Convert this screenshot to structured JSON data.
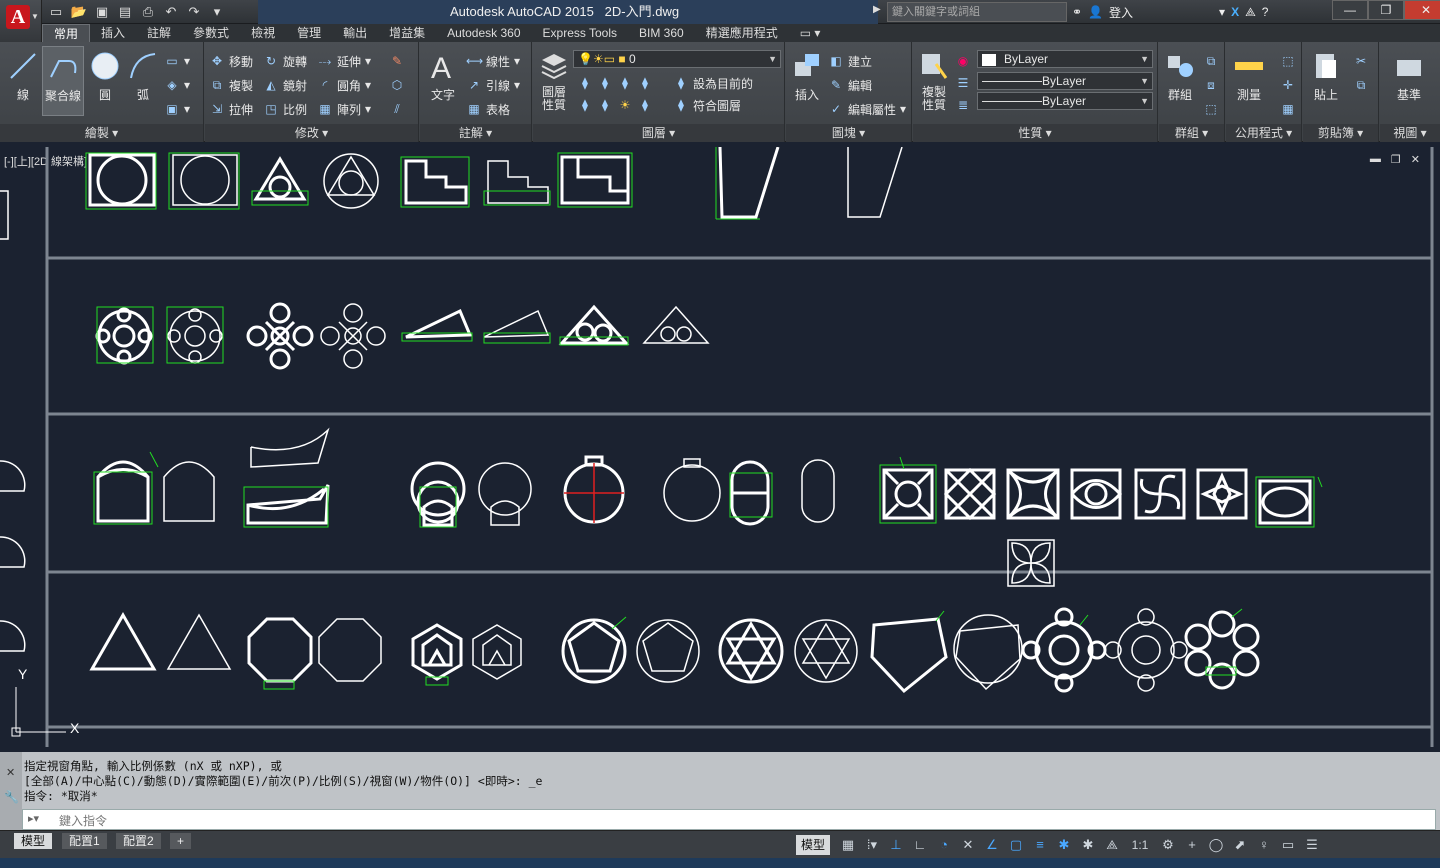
{
  "app": {
    "title": "Autodesk AutoCAD 2015",
    "file": "2D-入門.dwg",
    "logo_letter": "A"
  },
  "search": {
    "placeholder": "鍵入關鍵字或詞組"
  },
  "signin": {
    "label": "登入"
  },
  "ribbon_tabs": [
    "常用",
    "插入",
    "註解",
    "參數式",
    "檢視",
    "管理",
    "輸出",
    "增益集",
    "Autodesk 360",
    "Express Tools",
    "BIM 360",
    "精選應用程式"
  ],
  "panels": {
    "draw": {
      "title": "繪製",
      "line": "線",
      "polyline": "聚合線",
      "circle": "圓",
      "arc": "弧"
    },
    "modify": {
      "title": "修改",
      "move": "移動",
      "rotate": "旋轉",
      "trim": "延伸",
      "copy": "複製",
      "mirror": "鏡射",
      "fillet": "圓角",
      "stretch": "拉伸",
      "scale": "比例",
      "array": "陣列"
    },
    "annotation": {
      "title": "註解",
      "text": "文字",
      "linear": "線性",
      "leader": "引線",
      "table": "表格"
    },
    "layers": {
      "title": "圖層",
      "props": "圖層性質",
      "layer_value": "0",
      "set_current": "設為目前的",
      "match": "符合圖層"
    },
    "block": {
      "title": "圖塊",
      "insert": "插入",
      "create": "建立",
      "edit": "編輯",
      "edit_attr": "編輯屬性"
    },
    "properties": {
      "title": "性質",
      "match": "複製性質",
      "color": "ByLayer",
      "linetype": "ByLayer",
      "lineweight": "ByLayer"
    },
    "groups": {
      "title": "群組",
      "group": "群組"
    },
    "utilities": {
      "title": "公用程式",
      "measure": "測量"
    },
    "clipboard": {
      "title": "剪貼簿",
      "paste": "貼上"
    },
    "view": {
      "title": "視圖",
      "base": "基準"
    }
  },
  "viewport": {
    "label": "[-][上][2D 線架構]"
  },
  "command": {
    "history": [
      "指定視窗角點, 輸入比例係數 (nX 或 nXP), 或",
      "[全部(A)/中心點(C)/動態(D)/實際範圍(E)/前次(P)/比例(S)/視窗(W)/物件(O)] <即時>: _e",
      "指令: *取消*"
    ],
    "placeholder": "鍵入指令"
  },
  "layouts": [
    "模型",
    "配置1",
    "配置2"
  ],
  "status": {
    "model": "模型",
    "scale": "1:1"
  },
  "colors": {
    "accent_green": "#22dd22",
    "bg": "#1b2230",
    "red": "#e02020"
  }
}
